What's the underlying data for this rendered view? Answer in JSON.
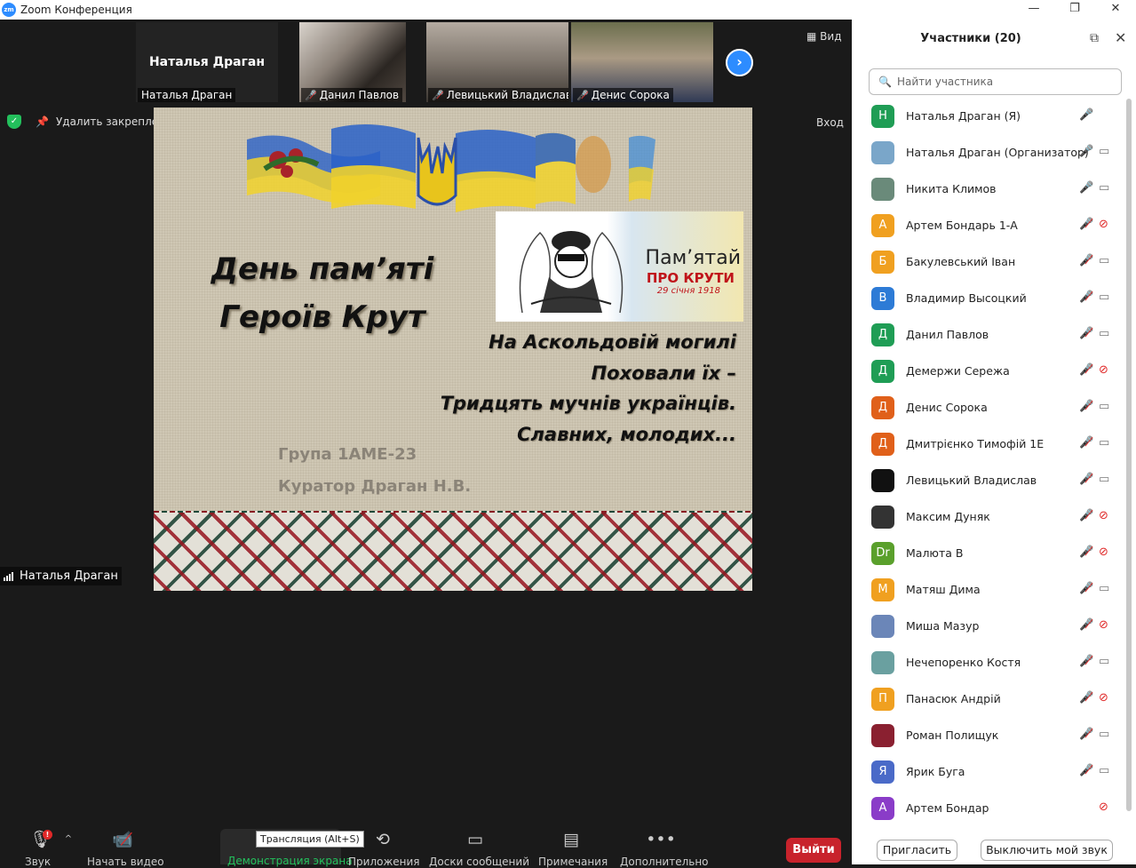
{
  "app": {
    "title": "Zoom Конференция",
    "logo_text": "zm"
  },
  "window_controls": {
    "minimize": "—",
    "maximize": "❐",
    "close": "✕"
  },
  "thumbnails": {
    "host_big_name": "Наталья Драган",
    "host_tag": "Наталья Драган",
    "cam1_tag": "Данил Павлов",
    "cam2_tag": "Левицький Владислав",
    "cam3_tag": "Денис Сорока"
  },
  "view_label": "Вид",
  "top_bar": {
    "unpin_label": "Удалить закреплен",
    "enter_label": "Вход"
  },
  "slide": {
    "title_line1": "День пам’яті",
    "title_line2": "Героїв Крут",
    "poster_line1": "Пам’ятай",
    "poster_line2": "ПРО КРУТИ",
    "poster_line3": "29 січня 1918",
    "poem": [
      "На Аскольдовій могилі",
      "Поховали їх –",
      "Тридцять мучнів українців.",
      "Славних, молодих..."
    ],
    "group": "Група 1АМЕ-23",
    "curator": "Куратор Драган Н.В."
  },
  "speaker_tag": "Наталья Драган",
  "toolbar": {
    "sound": "Звук",
    "video": "Начать видео",
    "share": "Демонстрация экрана",
    "share_tooltip": "Трансляция (Alt+S)",
    "apps": "Приложения",
    "whiteboards": "Доски сообщений",
    "notes": "Примечания",
    "more": "Дополнительно",
    "leave": "Выйти",
    "badge": "!"
  },
  "participants_panel": {
    "title": "Участники (20)",
    "search_placeholder": "Найти участника",
    "invite": "Пригласить",
    "mute_self": "Выключить мой звук",
    "list": [
      {
        "name": "Наталья Драган (Я)",
        "initial": "Н",
        "color": "#1f9d55",
        "mic": "on",
        "cam": "none"
      },
      {
        "name": "Наталья Драган (Организатор)",
        "initial": "",
        "color": "#7aa6c9",
        "mic": "on",
        "cam": "on"
      },
      {
        "name": "Никита Климов",
        "initial": "",
        "color": "#6a8a7a",
        "mic": "on",
        "cam": "on"
      },
      {
        "name": "Артем Бондарь 1-А",
        "initial": "А",
        "color": "#f0a020",
        "mic": "muted",
        "cam": "off"
      },
      {
        "name": "Бакулевський Іван",
        "initial": "Б",
        "color": "#f0a020",
        "mic": "muted",
        "cam": "on"
      },
      {
        "name": "Владимир Высоцкий",
        "initial": "В",
        "color": "#2d7bd6",
        "mic": "muted",
        "cam": "on"
      },
      {
        "name": "Данил Павлов",
        "initial": "Д",
        "color": "#1f9d55",
        "mic": "muted",
        "cam": "on"
      },
      {
        "name": "Демержи Сережа",
        "initial": "Д",
        "color": "#1f9d55",
        "mic": "muted",
        "cam": "off"
      },
      {
        "name": "Денис Сорока",
        "initial": "Д",
        "color": "#e0601a",
        "mic": "muted",
        "cam": "on"
      },
      {
        "name": "Дмитрієнко Тимофій 1Е",
        "initial": "Д",
        "color": "#e0601a",
        "mic": "muted",
        "cam": "on"
      },
      {
        "name": "Левицький Владислав",
        "initial": "",
        "color": "#111111",
        "mic": "muted",
        "cam": "on"
      },
      {
        "name": "Максим Дуняк",
        "initial": "",
        "color": "#333333",
        "mic": "muted",
        "cam": "off"
      },
      {
        "name": "Малюта В",
        "initial": "Dr",
        "color": "#5aa02c",
        "mic": "muted",
        "cam": "off"
      },
      {
        "name": "Матяш Дима",
        "initial": "М",
        "color": "#f0a020",
        "mic": "muted",
        "cam": "on"
      },
      {
        "name": "Миша Мазур",
        "initial": "",
        "color": "#6b86b8",
        "mic": "muted",
        "cam": "off"
      },
      {
        "name": "Нечепоренко Костя",
        "initial": "",
        "color": "#6aa0a0",
        "mic": "muted",
        "cam": "on"
      },
      {
        "name": "Панасюк Андрій",
        "initial": "П",
        "color": "#f0a020",
        "mic": "muted",
        "cam": "off"
      },
      {
        "name": "Роман Полищук",
        "initial": "",
        "color": "#8a2030",
        "mic": "muted",
        "cam": "on"
      },
      {
        "name": "Ярик Буга",
        "initial": "Я",
        "color": "#4a6ac8",
        "mic": "muted",
        "cam": "on"
      },
      {
        "name": "Артем Бондар",
        "initial": "А",
        "color": "#8a3cc8",
        "mic": "none",
        "cam": "off"
      }
    ]
  }
}
